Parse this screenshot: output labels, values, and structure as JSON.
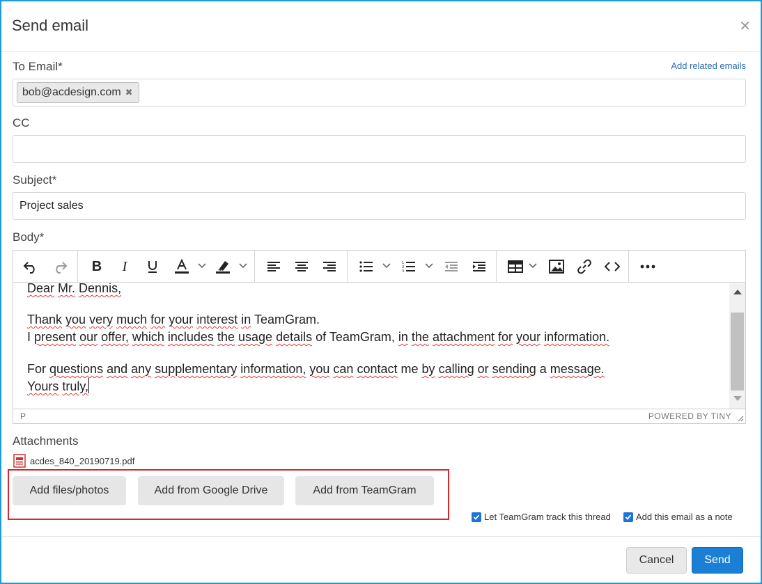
{
  "dialog": {
    "title": "Send email",
    "close_icon": "close-icon"
  },
  "to": {
    "label": "To Email*",
    "related_link": "Add related emails",
    "chips": [
      "bob@acdesign.com"
    ],
    "chip_remove_glyph": "✖"
  },
  "cc": {
    "label": "CC",
    "value": ""
  },
  "subject": {
    "label": "Subject*",
    "value": "Project sales"
  },
  "body": {
    "label": "Body*",
    "toolbar": [
      "undo-icon",
      "redo-icon",
      "bold-icon",
      "italic-icon",
      "underline-icon",
      "text-color-icon",
      "highlight-color-icon",
      "align-left-icon",
      "align-center-icon",
      "align-right-icon",
      "bullet-list-icon",
      "numbered-list-icon",
      "outdent-icon",
      "indent-icon",
      "table-icon",
      "image-icon",
      "link-icon",
      "code-icon",
      "more-icon"
    ],
    "greeting": "Dear Mr. Dennis,",
    "line1": "Thank you very much for your interest in TeamGram.",
    "line2": "I present our offer, which includes the usage details of TeamGram, in the attachment for your information.",
    "line3": "For questions and any supplementary information, you can contact me by calling or sending a message.",
    "closing": "Yours truly,",
    "status_path": "P",
    "powered_by": "POWERED BY TINY"
  },
  "attachments": {
    "label": "Attachments",
    "files": [
      "acdes_840_20190719.pdf"
    ],
    "buttons": {
      "add_files": "Add files/photos",
      "add_drive": "Add from Google Drive",
      "add_teamgram": "Add from TeamGram"
    }
  },
  "options": {
    "track_thread": {
      "label": "Let TeamGram track this thread",
      "checked": true
    },
    "add_note": {
      "label": "Add this email as a note",
      "checked": true
    }
  },
  "footer": {
    "cancel": "Cancel",
    "send": "Send"
  },
  "colors": {
    "accent": "#1b7fd6",
    "dialog_border": "#1f9bd8",
    "highlight_box": "#d9262c",
    "spellcheck": "#e53935"
  }
}
